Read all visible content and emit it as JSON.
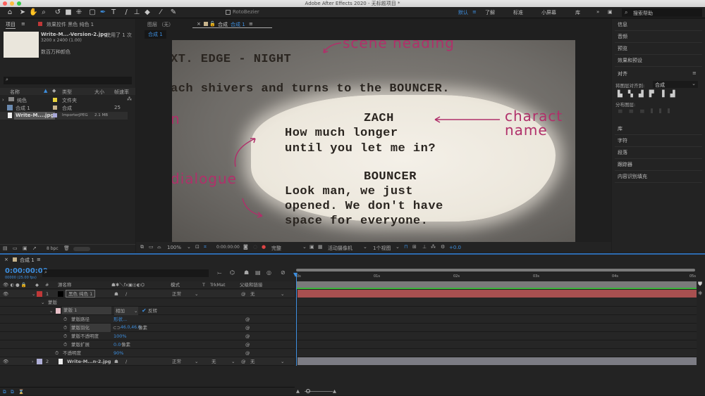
{
  "window": {
    "title": "Adobe After Effects 2020 - 无标题项目 *"
  },
  "toolbar": {
    "tools": [
      "home-icon",
      "selection-icon",
      "hand-icon",
      "zoom-icon",
      "rotate-icon",
      "camera-icon",
      "pan-behind-icon",
      "rectangle-icon",
      "pen-icon",
      "type-icon",
      "brush-icon",
      "clone-stamp-icon",
      "eraser-icon",
      "roto-brush-icon",
      "puppet-pin-icon"
    ],
    "active_tool": "pen-icon",
    "rotobezier": "RotoBezier",
    "workspaces": [
      "默认",
      "了解",
      "标准",
      "小屏幕",
      "库"
    ],
    "active_workspace": "默认",
    "search_placeholder": "搜索帮助"
  },
  "project": {
    "tab": "项目",
    "effects_tab": "效果控件 黑色 纯色 1",
    "file_name": "Write-M...-Version-2.jpg",
    "used": "，使用了 1 次",
    "dims": "3200 x 2400 (1.00)",
    "colors": "数百万种颜色",
    "search_placeholder": "",
    "columns": [
      "名称",
      "类型",
      "大小",
      "帧速率"
    ],
    "items": [
      {
        "name": "纯色",
        "type": "文件夹",
        "size": "",
        "fps": "",
        "color": "#e8d23c"
      },
      {
        "name": "合成 1",
        "type": "合成",
        "size": "",
        "fps": "25",
        "color": "#c8b48c"
      },
      {
        "name": "Write-M....jpg",
        "type": "ImporterJPEG",
        "size": "2.1 MB",
        "fps": "",
        "color": "#a8a8d8"
      }
    ],
    "bpc": "8 bpc"
  },
  "viewer": {
    "layer_tab": "图层 （无）",
    "comp_tab_prefix": "合成",
    "comp_tab": "合成 1",
    "breadcrumb": "合成 1",
    "screenplay": {
      "heading": "XT. EDGE - NIGHT",
      "action": "ach shivers and turns to the BOUNCER.",
      "char1": "ZACH",
      "line1a": "How much longer",
      "line1b": "until you let me in?",
      "char2": "BOUNCER",
      "line2a": "Look man, we just",
      "line2b": "opened. We don't have",
      "line2c": "space for everyone."
    },
    "annotations": {
      "scene": "scene heading",
      "char_a": "charact",
      "char_b": "name",
      "dialogue": "dialogue",
      "left": "n"
    },
    "footer": {
      "zoom": "100%",
      "timecode": "0:00:00:00",
      "resolution": "完整",
      "camera": "活动摄像机",
      "views": "1个视图",
      "exposure": "+0.0"
    }
  },
  "right_panel": {
    "items": [
      "信息",
      "音频",
      "预览",
      "效果和预设"
    ],
    "align_title": "对齐",
    "align_to_label": "将图层对齐到:",
    "align_to_value": "合成",
    "distribute_label": "分布图层:",
    "items2": [
      "库",
      "字符",
      "段落",
      "跟踪器",
      "内容识别填充"
    ]
  },
  "timeline": {
    "tab": "合成 1",
    "timecode": "0:00:00:00",
    "fps_info": "00000 (25.00 fps)",
    "columns": {
      "source": "源名称",
      "mode": "模式",
      "t": "T",
      "trkmat": "TrkMat",
      "parent": "父级和链接"
    },
    "ruler": [
      "0s",
      "01s",
      "02s",
      "03s",
      "04s",
      "05s"
    ],
    "layer1": {
      "num": "1",
      "name": "黑色 纯色 1",
      "mode": "正常",
      "parent": "无",
      "color": "#c03838"
    },
    "masks_label": "蒙版",
    "mask1": {
      "name": "蒙版 1",
      "mode": "相加",
      "inverted_label": "反转",
      "inverted": true,
      "color": "#e8c0c8"
    },
    "props": [
      {
        "name": "蒙版路径",
        "value": "形状..."
      },
      {
        "name": "蒙版羽化",
        "value": "46.0,46.0",
        "unit": "像素"
      },
      {
        "name": "蒙版不透明度",
        "value": "100%"
      },
      {
        "name": "蒙版扩展",
        "value": "0.0",
        "unit": "像素"
      }
    ],
    "opacity": {
      "name": "不透明度",
      "value": "90%"
    },
    "layer2": {
      "num": "2",
      "name": "Write-M...n-2.jpg",
      "mode": "正常",
      "trkmat": "无",
      "parent": "无",
      "color": "#b0b0d8"
    }
  }
}
